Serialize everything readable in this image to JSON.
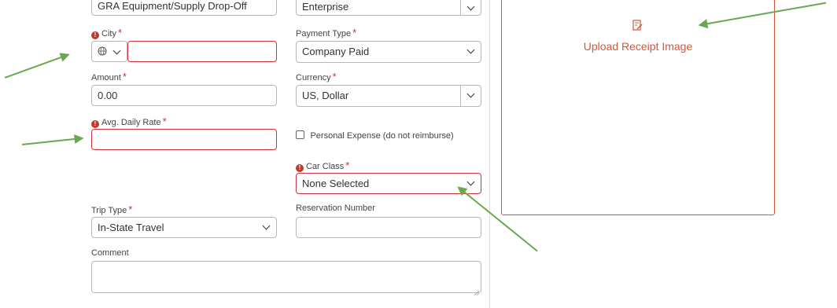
{
  "form": {
    "top_left_value": "GRA Equipment/Supply Drop-Off",
    "top_right_value": "Enterprise",
    "city_label": "City",
    "payment_type_label": "Payment Type",
    "payment_type_value": "Company Paid",
    "amount_label": "Amount",
    "amount_value": "0.00",
    "currency_label": "Currency",
    "currency_value": "US, Dollar",
    "avg_daily_rate_label": "Avg. Daily Rate",
    "personal_expense_label": "Personal Expense (do not reimburse)",
    "car_class_label": "Car Class",
    "car_class_value": "None Selected",
    "trip_type_label": "Trip Type",
    "trip_type_value": "In-State Travel",
    "reservation_label": "Reservation Number",
    "comment_label": "Comment",
    "required_mark": "*",
    "error_mark": "!"
  },
  "receipt": {
    "upload_label": "Upload Receipt Image",
    "icon": "receipt-edit-icon"
  },
  "colors": {
    "error": "#d0313a",
    "upload_text": "#d0583a",
    "annotation_arrow": "#6aa84f"
  }
}
